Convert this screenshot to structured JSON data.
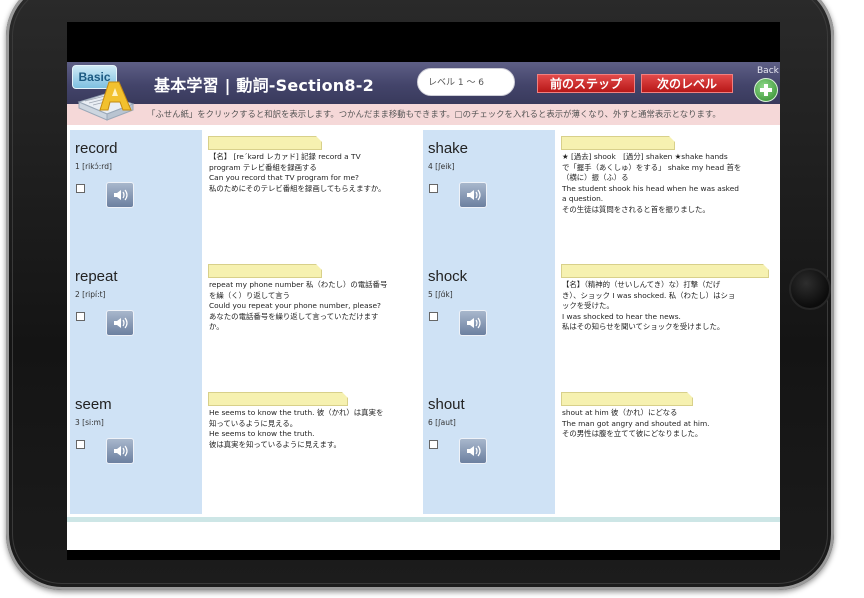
{
  "header": {
    "logo_label": "Basic",
    "title": "基本学習 | 動詞-Section8-2",
    "level": "レベル 1 〜 6",
    "prev_step": "前のステップ",
    "next_level": "次のレベル",
    "back_label": "Back"
  },
  "instruction": "「ふせん紙」をクリックすると和訳を表示します。つかんだまま移動もできます。□のチェックを入れると表示が薄くなり、外すと通常表示となります。",
  "words": [
    {
      "word": "record",
      "pron": "1  [rikɔ́:rd]",
      "lines": [
        "【名】 [re´kərd レカァド] 記録 record a TV",
        "program テレビ番組を録画する",
        "Can you record that TV program for me?",
        "私のためにそのテレビ番組を録画してもらえますか。"
      ]
    },
    {
      "word": "shake",
      "pron": "4  [ʃeik]",
      "lines": [
        "★ [過去] shook　[過分] shaken ★shake hands",
        "で「握手（あくしゅ）をする」 shake my head 首を",
        "（横に）振（ふ）る",
        "The student shook his head when he was asked",
        "a question.",
        "その生徒は質問をされると首を振りました。"
      ]
    },
    {
      "word": "repeat",
      "pron": "2  [ripí:t]",
      "lines": [
        "repeat my phone number 私（わたし）の電話番号",
        "を繰（く）り返して言う",
        "Could you repeat your phone number, please?",
        "あなたの電話番号を繰り返して言っていただけます",
        "か。"
      ]
    },
    {
      "word": "shock",
      "pron": "5  [ʃɑ́k]",
      "lines": [
        "【名】（精神的（せいしんてき）な）打撃（だげ",
        "き）、ショック I was shocked. 私（わたし）はショ",
        "ックを受けた。",
        "I was shocked to hear the news.",
        "私はその知らせを聞いてショックを受けました。"
      ]
    },
    {
      "word": "seem",
      "pron": "3  [si:m]",
      "lines": [
        "He seems to know the truth. 彼（かれ）は真実を",
        "知っているように見える。",
        "He seems to know the truth.",
        "彼は真実を知っているように見えます。"
      ]
    },
    {
      "word": "shout",
      "pron": "6  [ʃaut]",
      "lines": [
        "shout at him 彼（かれ）にどなる",
        "The man got angry and shouted at him.",
        "その男性は腹を立てて彼にどなりました。"
      ]
    }
  ]
}
